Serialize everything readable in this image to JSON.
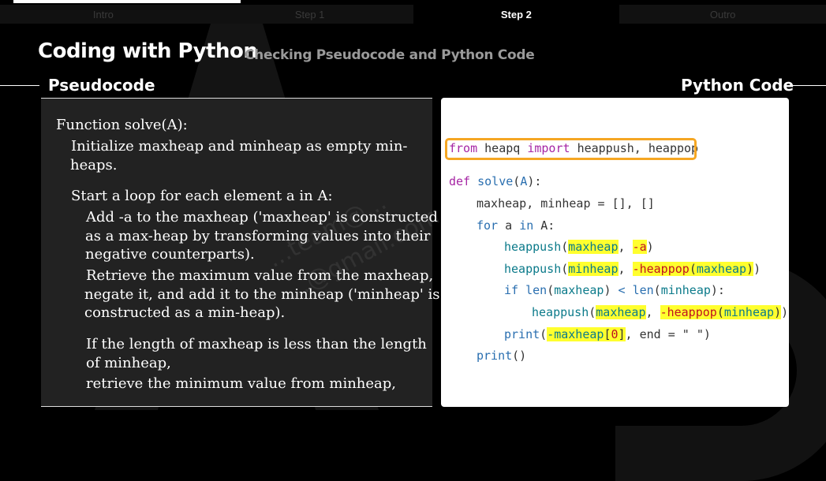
{
  "steps": [
    {
      "label": "Intro",
      "active": false
    },
    {
      "label": "Step 1",
      "active": false
    },
    {
      "label": "Step 2",
      "active": true
    },
    {
      "label": "Outro",
      "active": false
    }
  ],
  "header": {
    "title": "Coding with Python",
    "subtitle": "Checking Pseudocode and Python Code"
  },
  "pseudocode": {
    "label": "Pseudocode",
    "lines": [
      "Function solve(A):",
      "Initialize maxheap and minheap as empty min-",
      "heaps.",
      "Start a loop for each element a in A:",
      "Add -a to the maxheap ('maxheap' is constructed",
      "as a max-heap by transforming values into their",
      "negative counterparts).",
      "Retrieve the maximum value from the maxheap,",
      "negate it, and add it to the minheap ('minheap' is",
      "constructed as a min-heap).",
      "If the length of maxheap is less than the length",
      "of minheap,",
      "retrieve the minimum value from minheap,"
    ]
  },
  "python": {
    "label": "Python Code",
    "import_line": {
      "kw_from": "from",
      "module": "heapq",
      "kw_import": "import",
      "names": "heappush, heappop"
    },
    "def_kw": "def",
    "def_name": "solve",
    "def_arg": "A",
    "line_vars": "maxheap, minheap = [], []",
    "for_kw": "for",
    "for_var": "a",
    "in_kw": "in",
    "for_iter": "A:",
    "push1_fn": "heappush",
    "push1_arg1": "maxheap",
    "push1_arg2": "-a",
    "push2_fn": "heappush",
    "push2_arg1": "minheap",
    "push2_arg2a": "-heappop",
    "push2_arg2b": "maxheap",
    "if_kw": "if",
    "if_len1": "len",
    "if_arg1": "maxheap",
    "if_op": "<",
    "if_len2": "len",
    "if_arg2": "minheap",
    "push3_fn": "heappush",
    "push3_arg1": "maxheap",
    "push3_arg2a": "-heappop",
    "push3_arg2b": "minheap",
    "print1_fn": "print",
    "print1_arg_a": "-maxheap",
    "print1_arg_b": "0",
    "print1_end_kw": "end",
    "print1_end_val": "\" \"",
    "print2_fn": "print"
  },
  "watermark": {
    "line1": "...team@...",
    "line2": "...@gmail.com"
  }
}
